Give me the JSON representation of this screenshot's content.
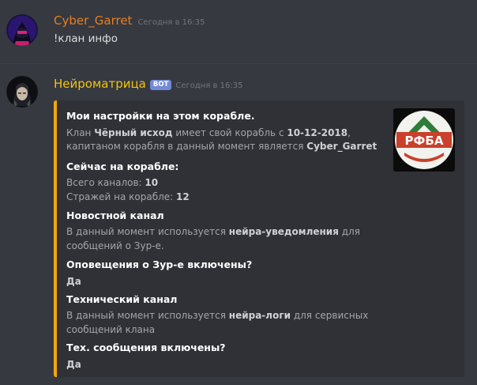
{
  "colors": {
    "background": "#36393f",
    "embed_background": "#2f3136",
    "embed_accent": "#f1a80c",
    "user_name": "#e67e22",
    "bot_name": "#f1c40f",
    "bot_tag": "#7289da"
  },
  "message1": {
    "author": "Cyber_Garret",
    "timestamp": "Сегодня в 16:35",
    "text": "!клан инфо"
  },
  "message2": {
    "author": "Нейроматрица",
    "bot_tag": "BOT",
    "timestamp": "Сегодня в 16:35",
    "embed": {
      "title": "Мои настройки на этом корабле.",
      "clan_line1": {
        "prefix": "Клан ",
        "clan_name": "Чёрный исход",
        "middle": " имеет свой корабль с ",
        "date": "10-12-2018",
        "suffix": ","
      },
      "clan_line2": {
        "prefix": "капитаном корабля в данный момент является ",
        "captain": "Cyber_Garret"
      },
      "section_ship": "Сейчас на корабле:",
      "channels": {
        "label": "Всего каналов: ",
        "value": "10"
      },
      "guards": {
        "label": "Стражей на корабле: ",
        "value": "12"
      },
      "section_news": "Новостной канал",
      "news_line1": {
        "prefix": "В данный момент используется ",
        "channel": "нейра-уведомления",
        "suffix": " для"
      },
      "news_line2": "сообщений о Зур-е.",
      "section_xur": "Оповещения о Зур-е включены?",
      "xur_value": "Да",
      "section_tech": "Технический канал",
      "tech_line1": {
        "prefix": "В данный момент используется ",
        "channel": "нейра-логи",
        "suffix": " для сервисных"
      },
      "tech_line2": "сообщений клана",
      "section_tech_msgs": "Тех. сообщения включены?",
      "tech_msgs_value": "Да",
      "thumbnail_text": "РФБА",
      "thumbnail_icon": "rfba-logo"
    }
  }
}
